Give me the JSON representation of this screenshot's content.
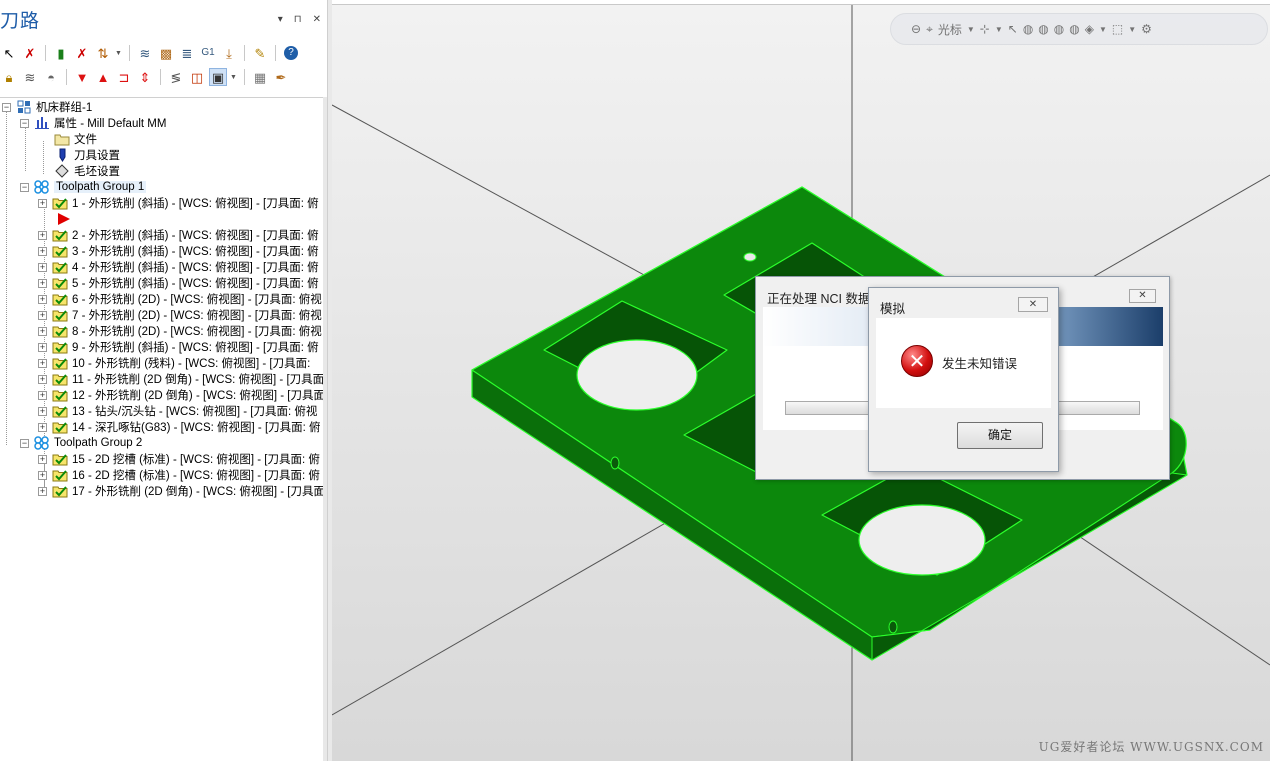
{
  "panel": {
    "title": "刀路",
    "controls": [
      "▾",
      "⊓",
      "✕"
    ]
  },
  "tree": {
    "root": "机床群组-1",
    "properties": "属性 - Mill Default MM",
    "prop_items": [
      "文件",
      "刀具设置",
      "毛坯设置"
    ],
    "group1": {
      "label": "Toolpath Group 1",
      "ops": [
        "1 - 外形铣削 (斜插) - [WCS: 俯视图] - [刀具面: 俯",
        "2 - 外形铣削 (斜插) - [WCS: 俯视图] - [刀具面: 俯",
        "3 - 外形铣削 (斜插) - [WCS: 俯视图] - [刀具面: 俯",
        "4 - 外形铣削 (斜插) - [WCS: 俯视图] - [刀具面: 俯",
        "5 - 外形铣削 (斜插) - [WCS: 俯视图] - [刀具面: 俯",
        "6 - 外形铣削 (2D) - [WCS: 俯视图] - [刀具面: 俯视",
        "7 - 外形铣削 (2D) - [WCS: 俯视图] - [刀具面: 俯视",
        "8 - 外形铣削 (2D) - [WCS: 俯视图] - [刀具面: 俯视",
        "9 - 外形铣削 (斜插) - [WCS: 俯视图] - [刀具面: 俯",
        "10 - 外形铣削 (残料) - [WCS: 俯视图] - [刀具面: ",
        "11 - 外形铣削 (2D 倒角) - [WCS: 俯视图] - [刀具面",
        "12 - 外形铣削 (2D 倒角) - [WCS: 俯视图] - [刀具面",
        "13 - 钻头/沉头钻 - [WCS: 俯视图] - [刀具面: 俯视",
        "14 - 深孔啄钻(G83) - [WCS: 俯视图] - [刀具面: 俯"
      ]
    },
    "group2": {
      "label": "Toolpath Group 2",
      "ops": [
        "15 - 2D 挖槽 (标准) - [WCS: 俯视图] - [刀具面: 俯",
        "16 - 2D 挖槽 (标准) - [WCS: 俯视图] - [刀具面: 俯",
        "17 - 外形铣削 (2D 倒角) - [WCS: 俯视图] - [刀具面"
      ]
    }
  },
  "viewport": {
    "toolbar_label": "光标",
    "watermark": "UG爱好者论坛 WWW.UGSNX.COM",
    "part_color": "#0a7d0a",
    "edge_color": "#2bff2b"
  },
  "dialog_progress": {
    "title": "正在处理 NCI 数据",
    "close": "✕"
  },
  "dialog_error": {
    "title": "模拟",
    "close": "✕",
    "icon": "✕",
    "message": "发生未知错误",
    "ok_label": "确定"
  }
}
